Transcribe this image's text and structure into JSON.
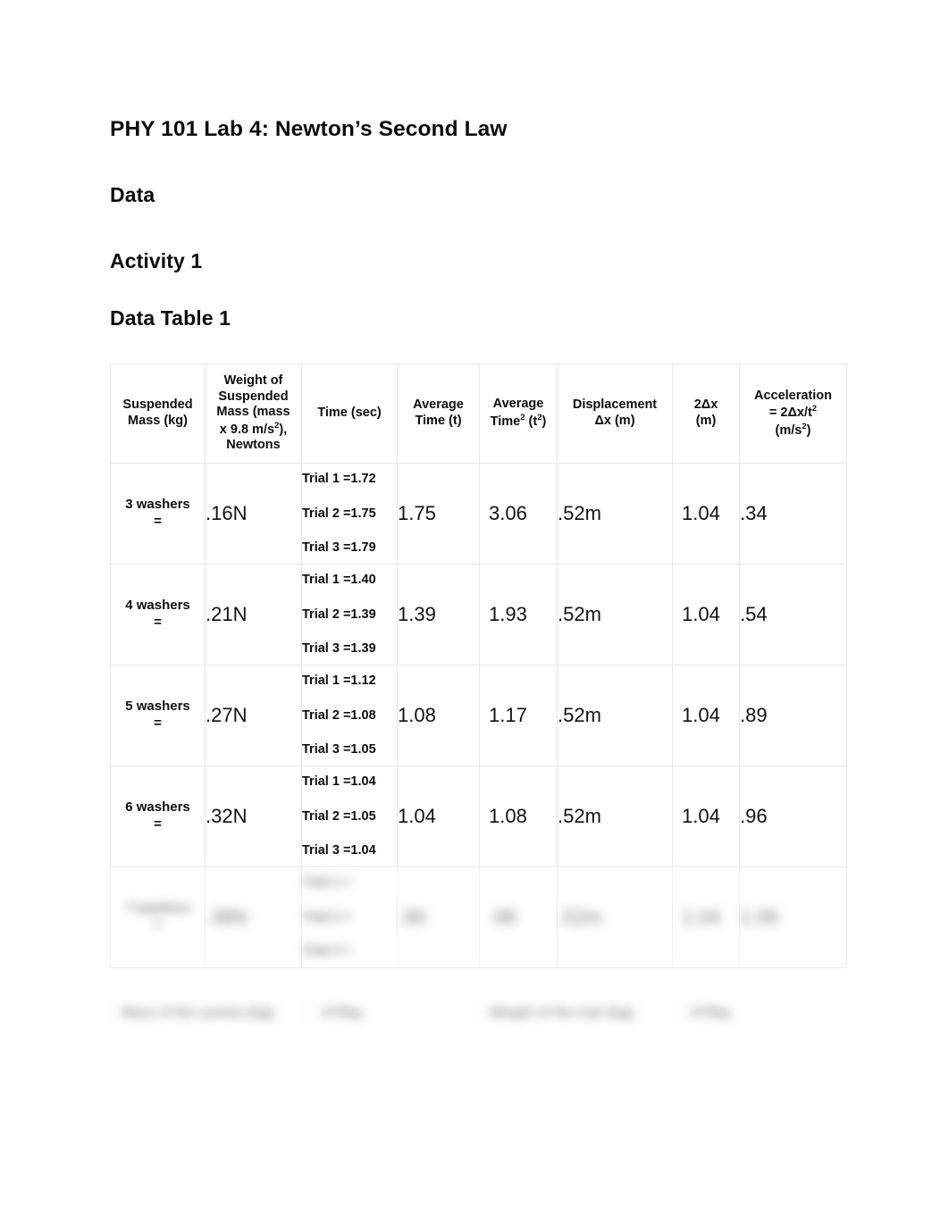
{
  "document": {
    "title": "PHY 101 Lab 4: Newton’s Second Law",
    "section_data": "Data",
    "section_activity": "Activity 1",
    "section_table": "Data Table 1"
  },
  "table": {
    "headers": [
      "Suspended Mass (kg)",
      "Weight of Suspended Mass (mass x 9.8 m/s2), Newtons",
      "Time (sec)",
      "Average Time (t)",
      "Average Time2 (t2)",
      "Displacement Δx (m)",
      "2Δx (m)",
      "Acceleration = 2Δx/t2 (m/s2)"
    ],
    "header_parts": {
      "c1_l1": "Suspended",
      "c1_l2": "Mass (kg)",
      "c2_l1": "Weight of",
      "c2_l2": "Suspended",
      "c2_l3": "Mass (mass",
      "c2_l4a": "x 9.8 m/s",
      "c2_l4b": "2",
      "c2_l4c": "),",
      "c2_l5": "Newtons",
      "c3_l1": "Time (sec)",
      "c4_l1": "Average",
      "c4_l2": "Time (t)",
      "c5_l1": "Average",
      "c5_l2a": "Time",
      "c5_l2b": "2",
      "c5_l2c": " (t",
      "c5_l2d": "2",
      "c5_l2e": ")",
      "c6_l1": "Displacement",
      "c6_l2": "Δx (m)",
      "c7_l1": "2Δx",
      "c7_l2": "(m)",
      "c8_l1": "Acceleration",
      "c8_l2a": "= 2Δx/t",
      "c8_l2b": "2",
      "c8_l3a": "(m/s",
      "c8_l3b": "2",
      "c8_l3c": ")"
    },
    "rows": [
      {
        "suspended_mass_l1": "3 washers",
        "suspended_mass_l2": "=",
        "weight": ".16N",
        "trial1": "Trial 1 =1.72",
        "trial2": "Trial 2 =1.75",
        "trial3": "Trial 3 =1.79",
        "avg_time": "1.75",
        "avg_time_sq": "3.06",
        "displacement": ".52m",
        "two_dx": "1.04",
        "acceleration": ".34"
      },
      {
        "suspended_mass_l1": "4 washers",
        "suspended_mass_l2": "=",
        "weight": ".21N",
        "trial1": "Trial 1 =1.40",
        "trial2": "Trial 2 =1.39",
        "trial3": "Trial 3 =1.39",
        "avg_time": "1.39",
        "avg_time_sq": "1.93",
        "displacement": ".52m",
        "two_dx": "1.04",
        "acceleration": ".54"
      },
      {
        "suspended_mass_l1": "5 washers",
        "suspended_mass_l2": "=",
        "weight": ".27N",
        "trial1": "Trial 1 =1.12",
        "trial2": "Trial 2 =1.08",
        "trial3": "Trial 3 =1.05",
        "avg_time": "1.08",
        "avg_time_sq": "1.17",
        "displacement": ".52m",
        "two_dx": "1.04",
        "acceleration": ".89"
      },
      {
        "suspended_mass_l1": "6 washers",
        "suspended_mass_l2": "=",
        "weight": ".32N",
        "trial1": "Trial 1 =1.04",
        "trial2": "Trial 2 =1.05",
        "trial3": "Trial 3 =1.04",
        "avg_time": "1.04",
        "avg_time_sq": "1.08",
        "displacement": ".52m",
        "two_dx": "1.04",
        "acceleration": ".96"
      }
    ],
    "blurred_row": {
      "suspended_mass_l1": "7 washers",
      "suspended_mass_l2": "=",
      "weight": ".38N",
      "trial1": "Trial 1 =",
      "trial2": "Trial 2 =",
      "trial3": "Trial 3 =",
      "avg_time": ".99",
      "avg_time_sq": ".98",
      "displacement": ".52m",
      "two_dx": "1.04",
      "acceleration": "1.06"
    }
  },
  "bottom_bar": {
    "label_1": "Mass of the system (kg)",
    "value_1": ".070kg",
    "label_2": "Weight of the Cart (kg)",
    "value_2": ".070kg"
  }
}
